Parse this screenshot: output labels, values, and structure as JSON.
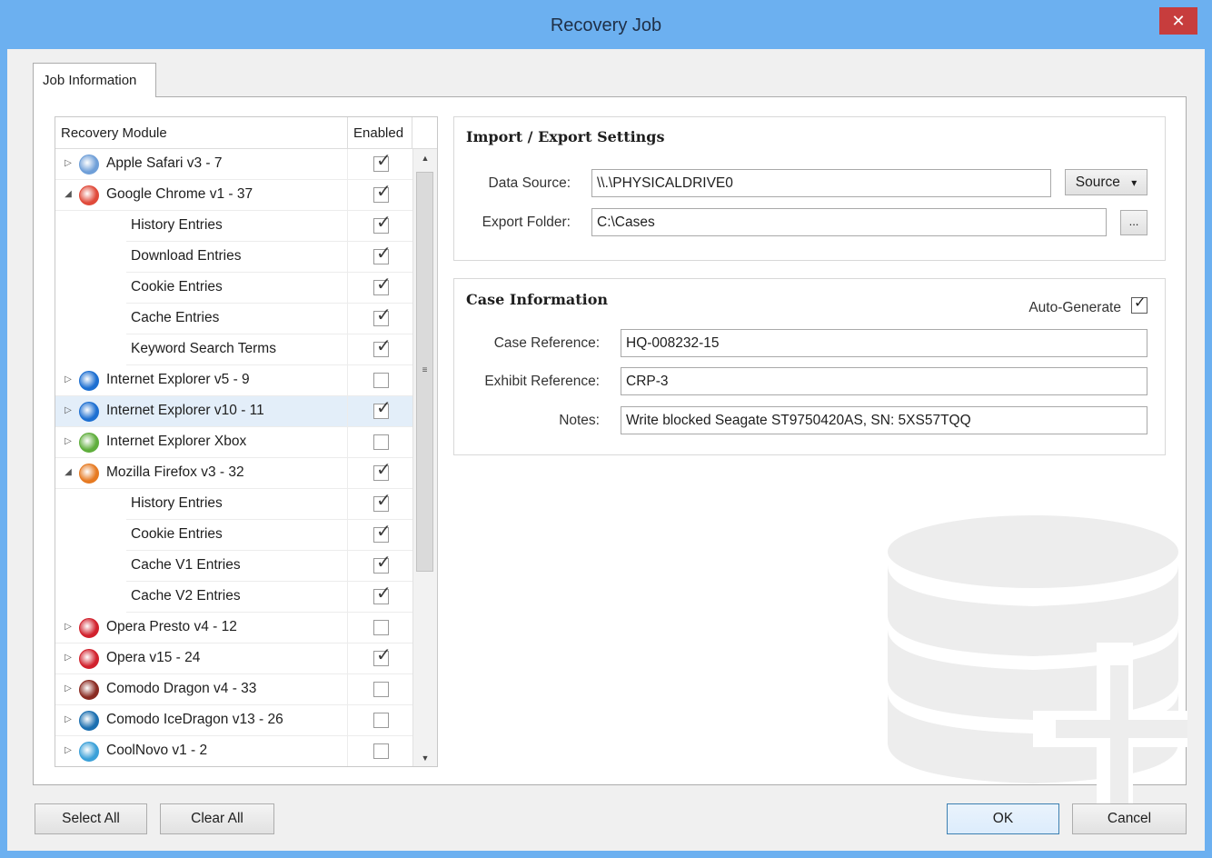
{
  "window": {
    "title": "Recovery Job",
    "close_label": "✕"
  },
  "tab": {
    "label": "Job Information"
  },
  "tree": {
    "header_module": "Recovery Module",
    "header_enabled": "Enabled",
    "rows": [
      {
        "label": "Apple Safari v3 - 7",
        "level": 0,
        "expander": "▷",
        "checked": true,
        "icon": "safari-icon",
        "color": "#6f9fd8"
      },
      {
        "label": "Google Chrome v1 - 37",
        "level": 0,
        "expander": "◢",
        "checked": true,
        "icon": "chrome-icon",
        "color": "#e04a3a"
      },
      {
        "label": "History Entries",
        "level": 1,
        "checked": true
      },
      {
        "label": "Download Entries",
        "level": 1,
        "checked": true
      },
      {
        "label": "Cookie Entries",
        "level": 1,
        "checked": true
      },
      {
        "label": "Cache Entries",
        "level": 1,
        "checked": true
      },
      {
        "label": "Keyword Search Terms",
        "level": 1,
        "checked": true
      },
      {
        "label": "Internet Explorer v5 - 9",
        "level": 0,
        "expander": "▷",
        "checked": false,
        "icon": "internet-explorer-icon",
        "color": "#1d6fd1"
      },
      {
        "label": "Internet Explorer v10 - 11",
        "level": 0,
        "expander": "▷",
        "checked": true,
        "icon": "internet-explorer-icon",
        "color": "#1d6fd1",
        "selected": true
      },
      {
        "label": "Internet Explorer Xbox",
        "level": 0,
        "expander": "▷",
        "checked": false,
        "icon": "xbox-icon",
        "color": "#5fae3c"
      },
      {
        "label": "Mozilla Firefox v3 - 32",
        "level": 0,
        "expander": "◢",
        "checked": true,
        "icon": "firefox-icon",
        "color": "#e67a22"
      },
      {
        "label": "History Entries",
        "level": 1,
        "checked": true
      },
      {
        "label": "Cookie Entries",
        "level": 1,
        "checked": true
      },
      {
        "label": "Cache V1 Entries",
        "level": 1,
        "checked": true
      },
      {
        "label": "Cache V2 Entries",
        "level": 1,
        "checked": true
      },
      {
        "label": "Opera Presto v4 - 12",
        "level": 0,
        "expander": "▷",
        "checked": false,
        "icon": "opera-icon",
        "color": "#d1212d"
      },
      {
        "label": "Opera v15 - 24",
        "level": 0,
        "expander": "▷",
        "checked": true,
        "icon": "opera-icon",
        "color": "#d1212d"
      },
      {
        "label": "Comodo Dragon v4 - 33",
        "level": 0,
        "expander": "▷",
        "checked": false,
        "icon": "comodo-dragon-icon",
        "color": "#8a2b22"
      },
      {
        "label": "Comodo IceDragon v13 - 26",
        "level": 0,
        "expander": "▷",
        "checked": false,
        "icon": "comodo-icedragon-icon",
        "color": "#1b6fb0"
      },
      {
        "label": "CoolNovo v1 - 2",
        "level": 0,
        "expander": "▷",
        "checked": false,
        "icon": "coolnovo-icon",
        "color": "#3aa0d8"
      }
    ]
  },
  "import_export": {
    "title": "Import / Export Settings",
    "data_source_label": "Data Source:",
    "data_source_value": "\\\\.\\PHYSICALDRIVE0",
    "source_button": "Source",
    "source_arrow": "▾",
    "export_folder_label": "Export Folder:",
    "export_folder_value": "C:\\Cases",
    "browse_button": "..."
  },
  "case_info": {
    "title": "Case Information",
    "auto_generate_label": "Auto-Generate",
    "auto_generate_checked": true,
    "case_reference_label": "Case Reference:",
    "case_reference_value": "HQ-008232-15",
    "exhibit_reference_label": "Exhibit Reference:",
    "exhibit_reference_value": "CRP-3",
    "notes_label": "Notes:",
    "notes_value": "Write blocked Seagate ST9750420AS, SN: 5XS57TQQ"
  },
  "footer": {
    "select_all": "Select All",
    "clear_all": "Clear All",
    "ok": "OK",
    "cancel": "Cancel"
  },
  "colors": {
    "window_frame": "#6cb0f0",
    "close_button": "#c73d3d",
    "selected_row": "#e3eef9"
  }
}
